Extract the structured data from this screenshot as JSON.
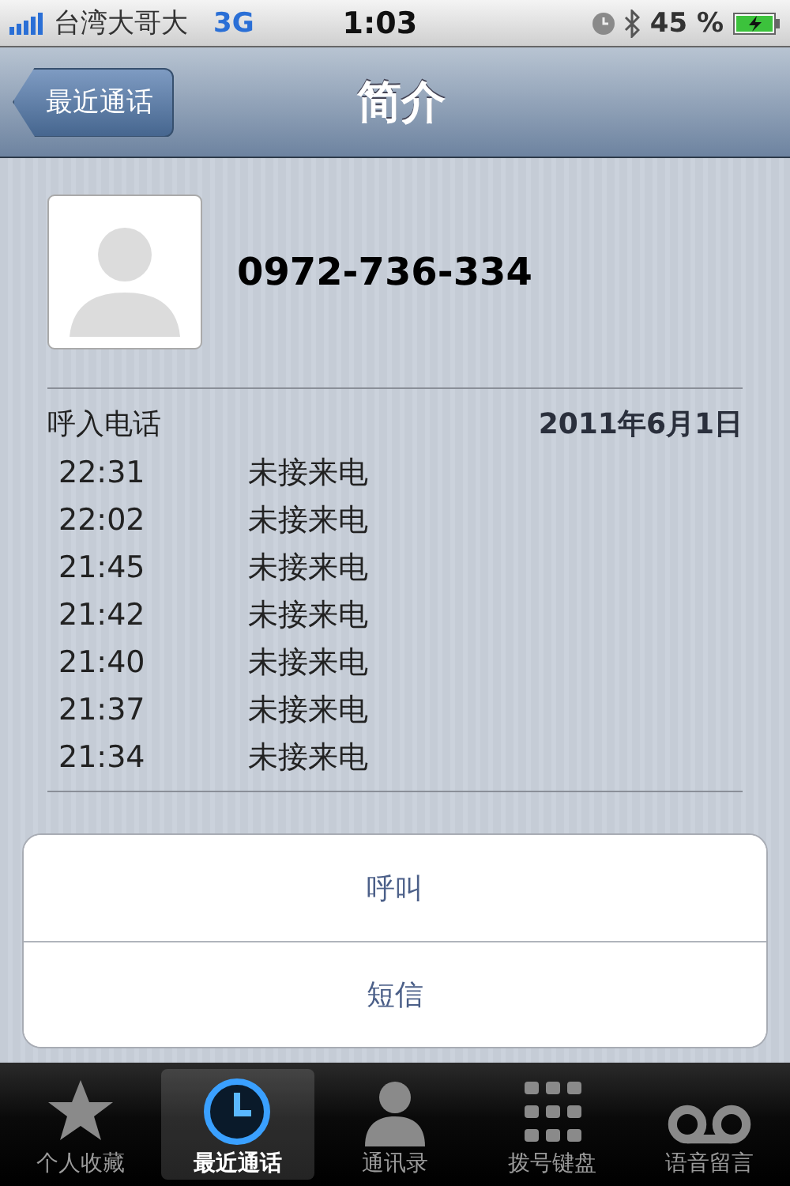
{
  "status_bar": {
    "carrier": "台湾大哥大",
    "network": "3G",
    "time": "1:03",
    "battery": "45 %"
  },
  "nav_bar": {
    "back": "最近通话",
    "title": "简介"
  },
  "contact": {
    "number": "0972-736-334"
  },
  "calls": {
    "heading": "呼入电话",
    "date": "2011年6月1日",
    "rows": [
      {
        "time": "22:31",
        "status": "未接来电"
      },
      {
        "time": "22:02",
        "status": "未接来电"
      },
      {
        "time": "21:45",
        "status": "未接来电"
      },
      {
        "time": "21:42",
        "status": "未接来电"
      },
      {
        "time": "21:40",
        "status": "未接来电"
      },
      {
        "time": "21:37",
        "status": "未接来电"
      },
      {
        "time": "21:34",
        "status": "未接来电"
      }
    ]
  },
  "actions": [
    "呼叫",
    "短信"
  ],
  "tab_bar": [
    {
      "label": "个人收藏",
      "selected": false
    },
    {
      "label": "最近通话",
      "selected": true
    },
    {
      "label": "通讯录",
      "selected": false
    },
    {
      "label": "拨号键盘",
      "selected": false
    },
    {
      "label": "语音留言",
      "selected": false
    }
  ]
}
